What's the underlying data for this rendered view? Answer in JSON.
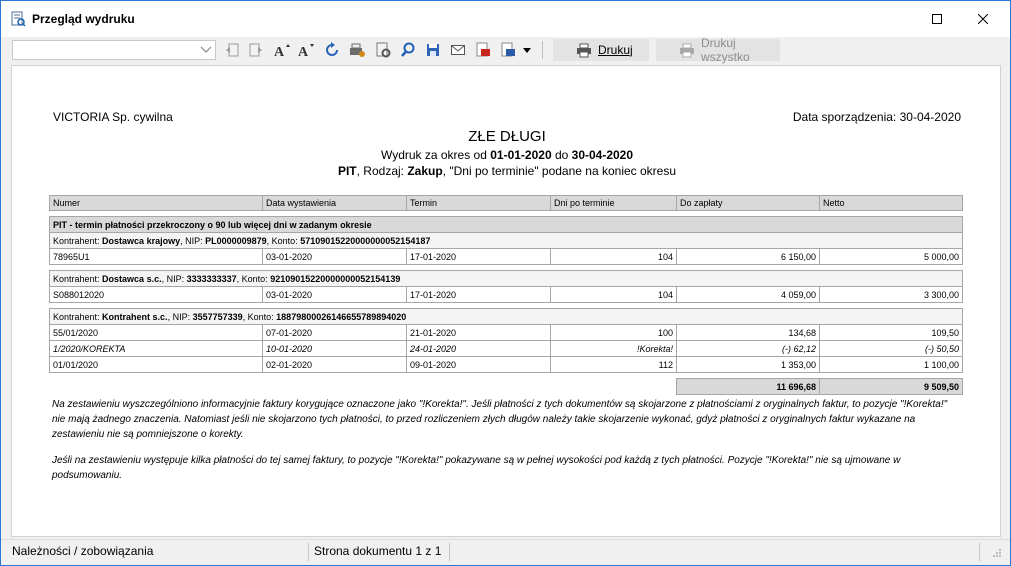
{
  "window": {
    "title": "Przegląd wydruku",
    "icons": [
      "print-preview-icon",
      "maximize-icon",
      "close-icon"
    ]
  },
  "toolbar": {
    "combo_value": "",
    "print_label": "Drukuj",
    "print_all_label": "Drukuj wszystko",
    "icons": [
      "export-icon",
      "export-page-icon",
      "font-increase-icon",
      "font-decrease-icon",
      "refresh-icon",
      "settings-icon",
      "page-settings-icon",
      "search-icon",
      "save-icon",
      "email-icon",
      "pdf-icon",
      "word-export-icon",
      "dropdown-icon"
    ]
  },
  "report": {
    "company": "VICTORIA Sp. cywilna",
    "created": "Data sporządzenia: 30-04-2020",
    "title": "ZŁE DŁUGI",
    "subtitle1_pre": "Wydruk za okres od ",
    "date_from": "01-01-2020",
    "subtitle1_mid": " do ",
    "date_to": "30-04-2020",
    "pit": "PIT",
    "subtitle2_mid": ", Rodzaj: ",
    "kind": "Zakup",
    "subtitle2_post": ", \"Dni po terminie\" podane na koniec okresu",
    "columns": [
      "Numer",
      "Data wystawienia",
      "Termin",
      "Dni po terminie",
      "Do zapłaty",
      "Netto"
    ],
    "group_title": "PIT - termin płatności przekroczony o 90 lub więcej dni w zadanym okresie",
    "contractor_label": "Kontrahent: ",
    "nip_label": ", NIP: ",
    "konto_label": ", Konto: ",
    "contractors": [
      {
        "name": "Dostawca krajowy",
        "nip": "PL0000009879",
        "konto": "57109015220000000052154187",
        "rows": [
          [
            "78965U1",
            "03-01-2020",
            "17-01-2020",
            "104",
            "6 150,00",
            "5 000,00"
          ]
        ]
      },
      {
        "name": "Dostawca s.c.",
        "nip": "3333333337",
        "konto": "92109015220000000052154139",
        "rows": [
          [
            "S088012020",
            "03-01-2020",
            "17-01-2020",
            "104",
            "4 059,00",
            "3 300,00"
          ]
        ]
      },
      {
        "name": "Kontrahent s.c.",
        "nip": "3557757339",
        "konto": "18879800026146655789894020",
        "rows": [
          [
            "55/01/2020",
            "07-01-2020",
            "21-01-2020",
            "100",
            "134,68",
            "109,50"
          ],
          [
            "1/2020/KOREKTA",
            "10-01-2020",
            "24-01-2020",
            "!Korekta!",
            "(-) 62,12",
            "(-) 50,50"
          ],
          [
            "01/01/2020",
            "02-01-2020",
            "09-01-2020",
            "112",
            "1 353,00",
            "1 100,00"
          ]
        ]
      }
    ],
    "total_to_pay": "11 696,68",
    "total_net": "9 509,50",
    "note1": "Na zestawieniu wyszczególniono informacyjnie faktury korygujące oznaczone jako \"!Korekta!\". Jeśli płatności z tych dokumentów są skojarzone z płatnościami z oryginalnych faktur, to pozycje \"!Korekta!\" nie mają żadnego znaczenia. Natomiast jeśli nie skojarzono tych płatności, to przed rozliczeniem złych długów należy takie skojarzenie wykonać, gdyż płatności z oryginalnych faktur wykazane na zestawieniu nie są pomniejszone o korekty.",
    "note2": "Jeśli na zestawieniu występuje kilka płatności do tej samej faktury, to pozycje \"!Korekta!\" pokazywane są w pełnej wysokości pod każdą z tych płatności. Pozycje \"!Korekta!\" nie są ujmowane w podsumowaniu."
  },
  "status": {
    "left": "Należności / zobowiązania",
    "page": "Strona dokumentu 1 z 1"
  }
}
